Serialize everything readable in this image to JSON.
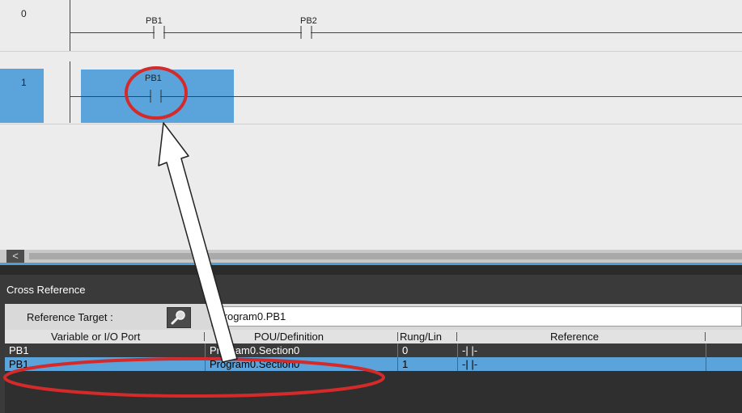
{
  "ladder": {
    "rungs": [
      {
        "number": "0",
        "contacts": [
          "PB1",
          "PB2"
        ]
      },
      {
        "number": "1",
        "contacts": [
          "PB1"
        ]
      }
    ],
    "scroll_left_glyph": "<"
  },
  "cross_reference": {
    "title": "Cross Reference",
    "reference_target_label": "Reference Target :",
    "reference_target_value": "Program0.PB1",
    "columns": [
      "Variable or I/O Port",
      "POU/Definition",
      "Rung/Lin",
      "Reference"
    ],
    "rows": [
      {
        "variable": "PB1",
        "pou": "Program0.Section0",
        "rung": "0",
        "reference": "-| |-",
        "selected": false
      },
      {
        "variable": "PB1",
        "pou": "Program0.Section0",
        "rung": "1",
        "reference": "-| |-",
        "selected": true
      }
    ]
  },
  "colors": {
    "selection": "#5aa3db",
    "highlight": "#d42a2a",
    "panel": "#3a3a3a"
  },
  "icons": [
    "search-icon",
    "scroll-left-icon"
  ]
}
